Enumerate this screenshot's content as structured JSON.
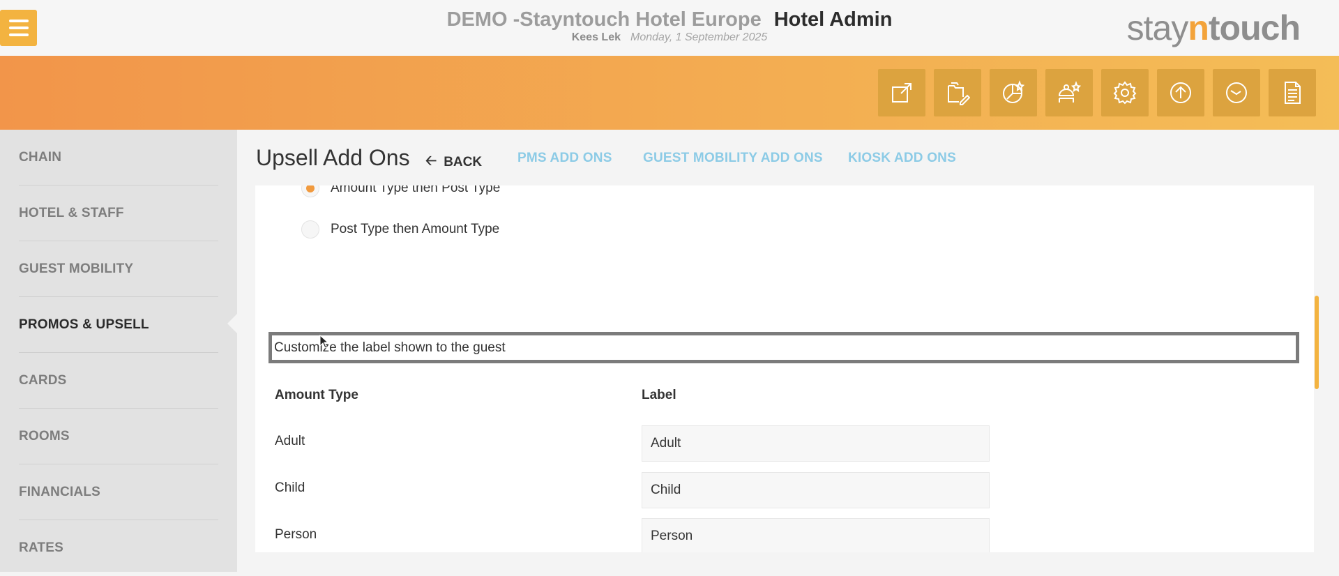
{
  "topbar": {
    "hotel_name": "DEMO -Stayntouch Hotel Europe",
    "app_name": "Hotel Admin",
    "user": "Kees Lek",
    "date": "Monday, 1 September 2025",
    "logo": {
      "part1": "stay",
      "part2": "n",
      "part3": "touch"
    }
  },
  "toolbar": {
    "icons": [
      "external-link-icon",
      "pages-edit-icon",
      "analytics-icon",
      "concierge-icon",
      "gear-icon",
      "upload-icon",
      "timer-icon",
      "document-icon"
    ]
  },
  "sidebar": {
    "items": [
      {
        "label": "CHAIN"
      },
      {
        "label": "HOTEL & STAFF"
      },
      {
        "label": "GUEST MOBILITY"
      },
      {
        "label": "PROMOS & UPSELL",
        "active": true
      },
      {
        "label": "CARDS"
      },
      {
        "label": "ROOMS"
      },
      {
        "label": "FINANCIALS"
      },
      {
        "label": "RATES"
      }
    ]
  },
  "header": {
    "title": "Upsell Add Ons",
    "back_label": "BACK",
    "tabs": [
      {
        "label": "PMS ADD ONS"
      },
      {
        "label": "GUEST MOBILITY ADD ONS"
      },
      {
        "label": "KIOSK ADD ONS"
      }
    ]
  },
  "main": {
    "radio_options": [
      {
        "label": "Amount Type then Post Type",
        "selected": true
      },
      {
        "label": "Post Type then Amount Type",
        "selected": false
      }
    ],
    "customize_label": "Customize the label shown to the guest",
    "table": {
      "headers": [
        "Amount Type",
        "Label"
      ],
      "rows": [
        {
          "amount_type": "Adult",
          "label": "Adult"
        },
        {
          "amount_type": "Child",
          "label": "Child"
        },
        {
          "amount_type": "Person",
          "label": "Person"
        }
      ]
    }
  },
  "colors": {
    "accent": "#f3b340",
    "selected_radio": "#f19a3e",
    "tab_link": "#8ccbe6",
    "toolbar_button": "#dca33f"
  }
}
